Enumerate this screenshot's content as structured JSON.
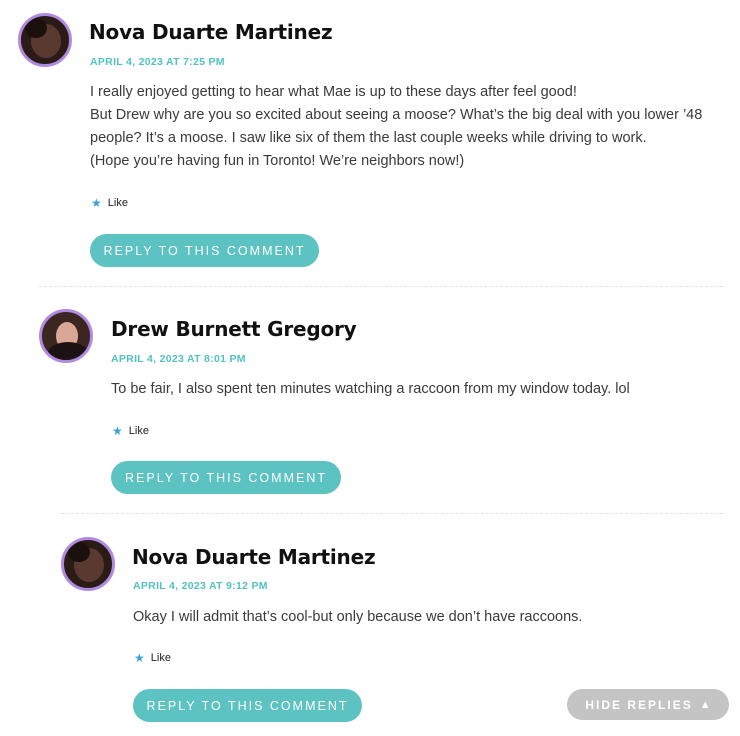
{
  "comments": [
    {
      "author": "Nova Duarte Martinez",
      "date": "APRIL 4, 2023 AT 7:25 PM",
      "lines": [
        "I really enjoyed getting to hear what Mae is up to these days after feel good!",
        "But Drew why are you so excited about seeing a moose? What’s the big deal with you lower ’48 people? It’s a moose. I saw like six of them the last couple weeks while driving to work.",
        "(Hope you’re having fun in Toronto! We’re neighbors now!)"
      ],
      "like_label": "Like",
      "reply_label": "REPLY TO THIS COMMENT"
    },
    {
      "author": "Drew Burnett Gregory",
      "date": "APRIL 4, 2023 AT 8:01 PM",
      "lines": [
        "To be fair, I also spent ten minutes watching a raccoon from my window today. lol"
      ],
      "like_label": "Like",
      "reply_label": "REPLY TO THIS COMMENT"
    },
    {
      "author": "Nova Duarte Martinez",
      "date": "APRIL 4, 2023 AT 9:12 PM",
      "lines": [
        "Okay I will admit that’s cool-but only because we don’t have raccoons."
      ],
      "like_label": "Like",
      "reply_label": "REPLY TO THIS COMMENT"
    }
  ],
  "hide_replies_label": "HIDE REPLIES",
  "icons": {
    "like": "star-icon",
    "hide": "triangle-up-icon"
  },
  "colors": {
    "accent": "#5cc3c2",
    "date": "#52c1c0",
    "avatar_ring": "#b08ae0",
    "hide_button": "#c4c4c4"
  }
}
